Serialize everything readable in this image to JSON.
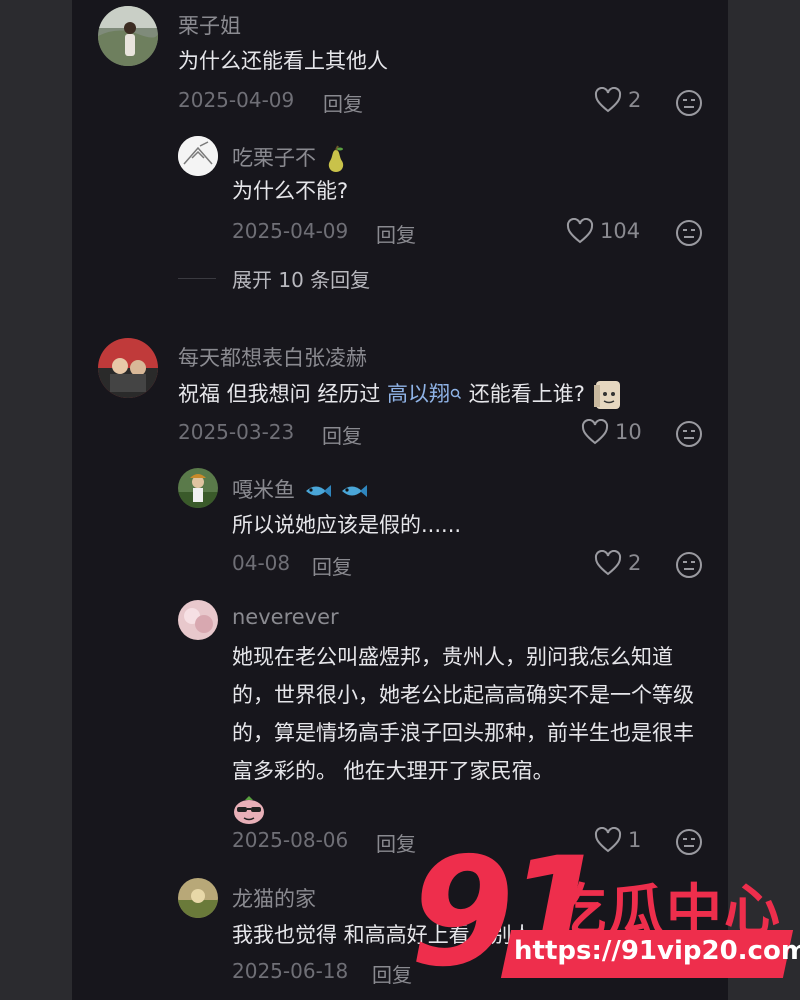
{
  "comments": [
    {
      "username": "栗子姐",
      "text": "为什么还能看上其他人",
      "date": "2025-04-09",
      "reply_label": "回复",
      "likes": "2",
      "replies": [
        {
          "username": "吃栗子不",
          "username_emoji": "pear-emoji",
          "text": "为什么不能?",
          "date": "2025-04-09",
          "reply_label": "回复",
          "likes": "104"
        }
      ],
      "expand_label": "展开 10 条回复"
    },
    {
      "username": "每天都想表白张凌赫",
      "text_before": "祝福 但我想问 经历过 ",
      "mention": "高以翔",
      "text_after": " 还能看上谁?",
      "date": "2025-03-23",
      "reply_label": "回复",
      "likes": "10",
      "replies": [
        {
          "username": "嘎米鱼",
          "username_emoji": "fish-emoji",
          "text": "所以说她应该是假的......",
          "date": "04-08",
          "reply_label": "回复",
          "likes": "2"
        },
        {
          "username": "neverever",
          "text": "她现在老公叫盛煜邦，贵州人，别问我怎么知道的，世界很小，她老公比起高高确实不是一个等级的，算是情场高手浪子回头那种，前半生也是很丰富多彩的。 他在大理开了家民宿。",
          "date": "2025-08-06",
          "reply_label": "回复",
          "likes": "1"
        },
        {
          "username": "龙猫的家",
          "text": "我我也觉得 和高高好",
          "text_partial_tail": "上看上别人",
          "date": "2025-06-18",
          "reply_label": "回复"
        }
      ]
    }
  ],
  "watermark": {
    "number": "91",
    "title": "吃瓜中心",
    "url": "https://91vip20.com"
  },
  "colors": {
    "background": "#17161c",
    "outer": "#2b2b2f",
    "mention": "#8fb3e6",
    "brand": "#ee2e4c"
  }
}
